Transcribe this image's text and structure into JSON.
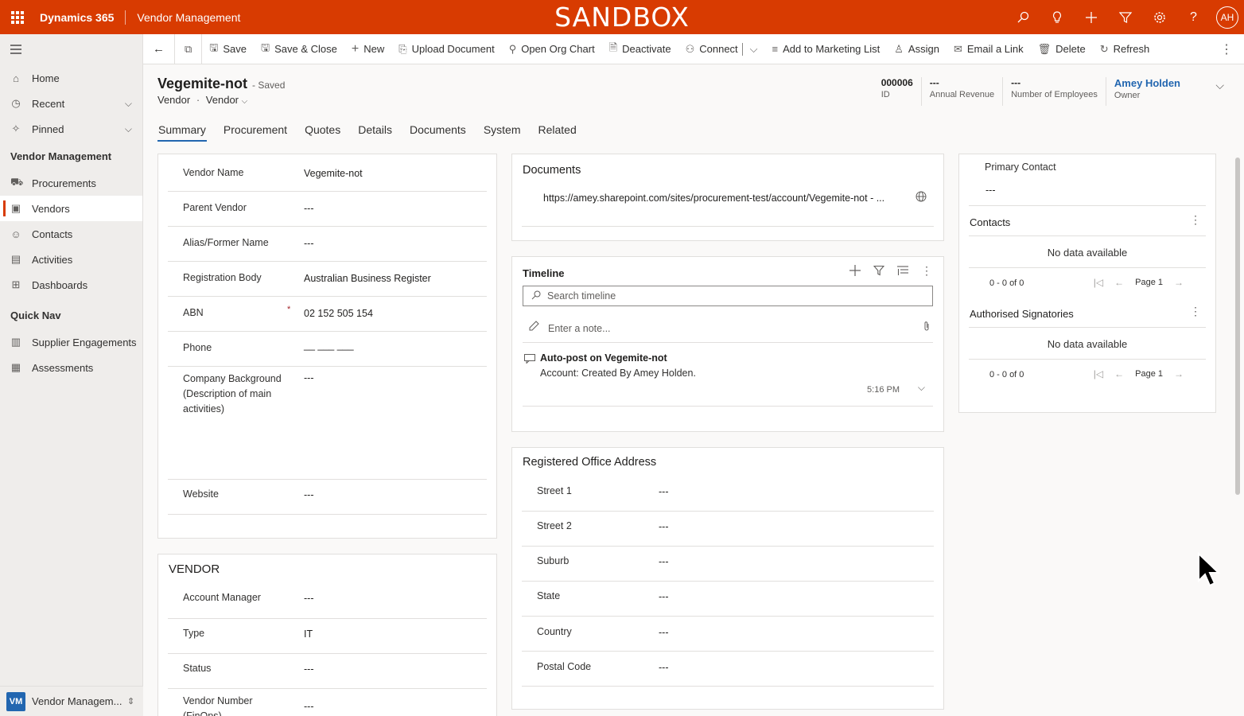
{
  "topbar": {
    "brand": "Dynamics 365",
    "app": "Vendor Management",
    "environment": "SANDBOX",
    "icons": [
      "search-icon",
      "lightbulb-icon",
      "plus-icon",
      "filter-icon",
      "gear-icon",
      "help-icon"
    ],
    "user_initials": "AH"
  },
  "sidebar": {
    "items": [
      {
        "label": "Home",
        "icon": "home-icon"
      },
      {
        "label": "Recent",
        "icon": "clock-icon"
      },
      {
        "label": "Pinned",
        "icon": "pin-icon"
      }
    ],
    "group1": "Vendor Management",
    "group1_items": [
      {
        "label": "Procurements",
        "icon": "cart-icon"
      },
      {
        "label": "Vendors",
        "icon": "vendor-icon"
      },
      {
        "label": "Contacts",
        "icon": "person-icon"
      },
      {
        "label": "Activities",
        "icon": "clipboard-icon"
      },
      {
        "label": "Dashboards",
        "icon": "dashboard-icon"
      }
    ],
    "group2": "Quick Nav",
    "group2_items": [
      {
        "label": "Supplier Engagements",
        "icon": "engagement-icon"
      },
      {
        "label": "Assessments",
        "icon": "assessment-icon"
      }
    ],
    "area_badge": "VM",
    "area_label": "Vendor Managem..."
  },
  "commands": {
    "save": "Save",
    "save_close": "Save & Close",
    "new": "New",
    "upload": "Upload Document",
    "org_chart": "Open Org Chart",
    "deactivate": "Deactivate",
    "connect": "Connect",
    "marketing": "Add to Marketing List",
    "assign": "Assign",
    "email_link": "Email a Link",
    "delete": "Delete",
    "refresh": "Refresh"
  },
  "record": {
    "title": "Vegemite-not",
    "status": "- Saved",
    "entity": "Vendor",
    "form": "Vendor",
    "id_value": "000006",
    "id_label": "ID",
    "revenue_value": "---",
    "revenue_label": "Annual Revenue",
    "employees_value": "---",
    "employees_label": "Number of Employees",
    "owner_value": "Amey Holden",
    "owner_label": "Owner"
  },
  "tabs": [
    "Summary",
    "Procurement",
    "Quotes",
    "Details",
    "Documents",
    "System",
    "Related"
  ],
  "general": {
    "fields": [
      {
        "label": "Vendor Name",
        "value": "Vegemite-not"
      },
      {
        "label": "Parent Vendor",
        "value": "---"
      },
      {
        "label": "Alias/Former Name",
        "value": "---"
      },
      {
        "label": "Registration Body",
        "value": "Australian Business Register"
      },
      {
        "label": "ABN",
        "value": "02 152 505 154",
        "required_mark": "*"
      },
      {
        "label": "Phone",
        "value": "__ ___ ___"
      },
      {
        "label": "Company Background (Description of main activities)",
        "value": "---"
      },
      {
        "label": "Website",
        "value": "---"
      }
    ]
  },
  "vendor_section": {
    "title": "VENDOR",
    "fields": [
      {
        "label": "Account Manager",
        "value": "---"
      },
      {
        "label": "Type",
        "value": "IT"
      },
      {
        "label": "Status",
        "value": "---"
      },
      {
        "label": "Vendor Number (FinOps)",
        "value": "---"
      }
    ]
  },
  "documents": {
    "title": "Documents",
    "url": "https://amey.sharepoint.com/sites/procurement-test/account/Vegemite-not - ..."
  },
  "timeline": {
    "title": "Timeline",
    "search_placeholder": "Search timeline",
    "note_placeholder": "Enter a note...",
    "post_title": "Auto-post on Vegemite-not",
    "post_body": "Account: Created By Amey Holden.",
    "post_time": "5:16 PM"
  },
  "address": {
    "title": "Registered Office Address",
    "fields": [
      {
        "label": "Street 1",
        "value": "---"
      },
      {
        "label": "Street 2",
        "value": "---"
      },
      {
        "label": "Suburb",
        "value": "---"
      },
      {
        "label": "State",
        "value": "---"
      },
      {
        "label": "Country",
        "value": "---"
      },
      {
        "label": "Postal Code",
        "value": "---"
      }
    ]
  },
  "right_panel": {
    "primary_contact_label": "Primary Contact",
    "primary_contact_value": "---",
    "contacts_title": "Contacts",
    "contacts_nodata": "No data available",
    "contacts_count": "0 - 0 of 0",
    "contacts_page": "Page 1",
    "signatories_title": "Authorised Signatories",
    "signatories_nodata": "No data available",
    "signatories_count": "0 - 0 of 0",
    "signatories_page": "Page 1"
  },
  "colors": {
    "topbar": "#d83b01",
    "accent": "#2266b0",
    "area_badge": "#2266b0"
  }
}
